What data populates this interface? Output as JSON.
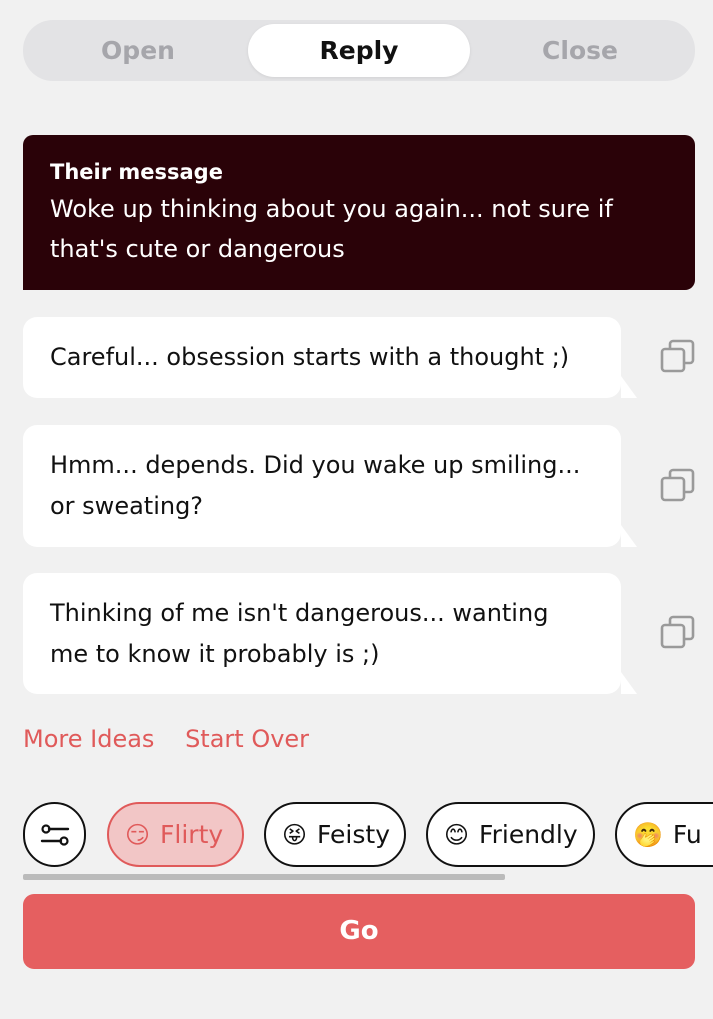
{
  "tabs": [
    {
      "label": "Open",
      "selected": false
    },
    {
      "label": "Reply",
      "selected": true
    },
    {
      "label": "Close",
      "selected": false
    }
  ],
  "their_message": {
    "label": "Their message",
    "text": "Woke up thinking about you again... not sure if that's cute or dangerous"
  },
  "replies": [
    {
      "text": "Careful... obsession starts with a thought ;)"
    },
    {
      "text": "Hmm... depends. Did you wake up smiling... or sweating?"
    },
    {
      "text": "Thinking of me isn't dangerous... wanting me to know it probably is ;)"
    }
  ],
  "actions": {
    "more_ideas": "More Ideas",
    "start_over": "Start Over"
  },
  "tones": [
    {
      "emoji": "😏",
      "label": "Flirty",
      "selected": true
    },
    {
      "emoji": "😝",
      "label": "Feisty",
      "selected": false
    },
    {
      "emoji": "😊",
      "label": "Friendly",
      "selected": false
    },
    {
      "emoji": "🤭",
      "label": "Fu",
      "selected": false
    }
  ],
  "icons": {
    "copy": "copy-icon",
    "filter": "sliders-icon"
  },
  "colors": {
    "accent": "#e55f60",
    "their_bg": "#2a0208"
  },
  "go_label": "Go"
}
